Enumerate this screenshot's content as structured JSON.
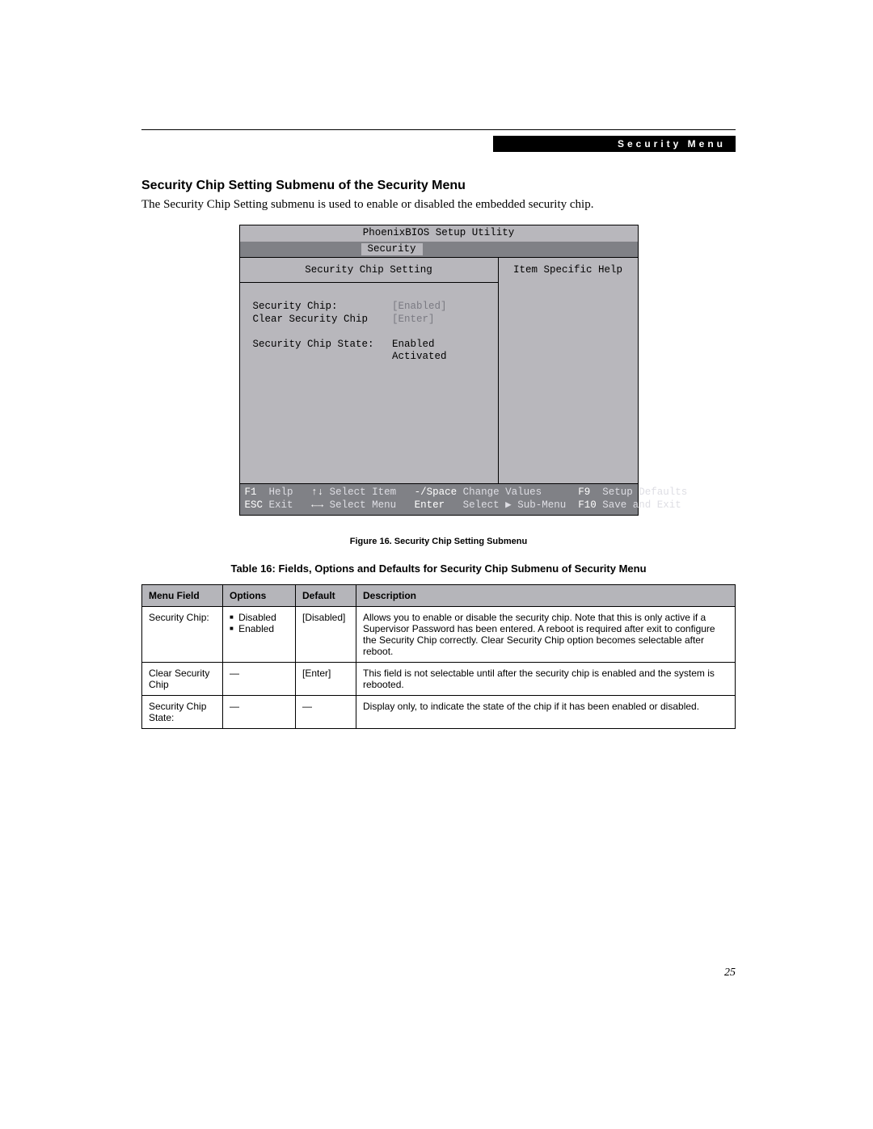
{
  "header": {
    "label": "Security Menu"
  },
  "section": {
    "title": "Security Chip Setting Submenu of the Security Menu",
    "text": "The Security Chip Setting submenu is used to enable or disabled the embedded security chip."
  },
  "bios": {
    "title": "PhoenixBIOS Setup Utility",
    "active_tab": "Security",
    "left_heading": "Security Chip Setting",
    "right_heading": "Item Specific Help",
    "rows": {
      "r1_label": "Security Chip:",
      "r1_value": "[Enabled]",
      "r2_label": "Clear Security Chip",
      "r2_value": "[Enter]",
      "r3_label": "Security Chip State:",
      "r3_value1": "Enabled",
      "r3_value2": "Activated"
    },
    "footer": {
      "f1": "F1",
      "help": "Help",
      "updown": "↑↓",
      "select_item": "Select Item",
      "minus_space": "-/Space",
      "change_values": "Change Values",
      "f9": "F9",
      "setup_defaults": "Setup Defaults",
      "esc": "ESC",
      "exit": "Exit",
      "leftright": "←→",
      "select_menu": "Select Menu",
      "enter": "Enter",
      "select_submenu": "Select ▶ Sub-Menu",
      "f10": "F10",
      "save_exit": "Save and Exit"
    }
  },
  "figure_caption": "Figure 16.  Security Chip Setting Submenu",
  "table_caption": "Table 16: Fields, Options and Defaults for Security Chip Submenu of Security Menu",
  "table": {
    "headers": [
      "Menu Field",
      "Options",
      "Default",
      "Description"
    ],
    "rows": [
      {
        "field": "Security Chip:",
        "options": [
          "Disabled",
          "Enabled"
        ],
        "default": "[Disabled]",
        "description": "Allows you to enable or disable the security chip. Note that this is only active if a Supervisor Password has been entered. A reboot is required after exit to configure the Security Chip correctly. Clear Security Chip option becomes selectable after reboot."
      },
      {
        "field": "Clear Security Chip",
        "options_text": "—",
        "default": "[Enter]",
        "description": "This field is not selectable until after the security chip is enabled and the system is rebooted."
      },
      {
        "field": "Security Chip State:",
        "options_text": "—",
        "default": "—",
        "description": "Display only, to indicate the state of the chip if it has been enabled or disabled."
      }
    ]
  },
  "page_number": "25"
}
